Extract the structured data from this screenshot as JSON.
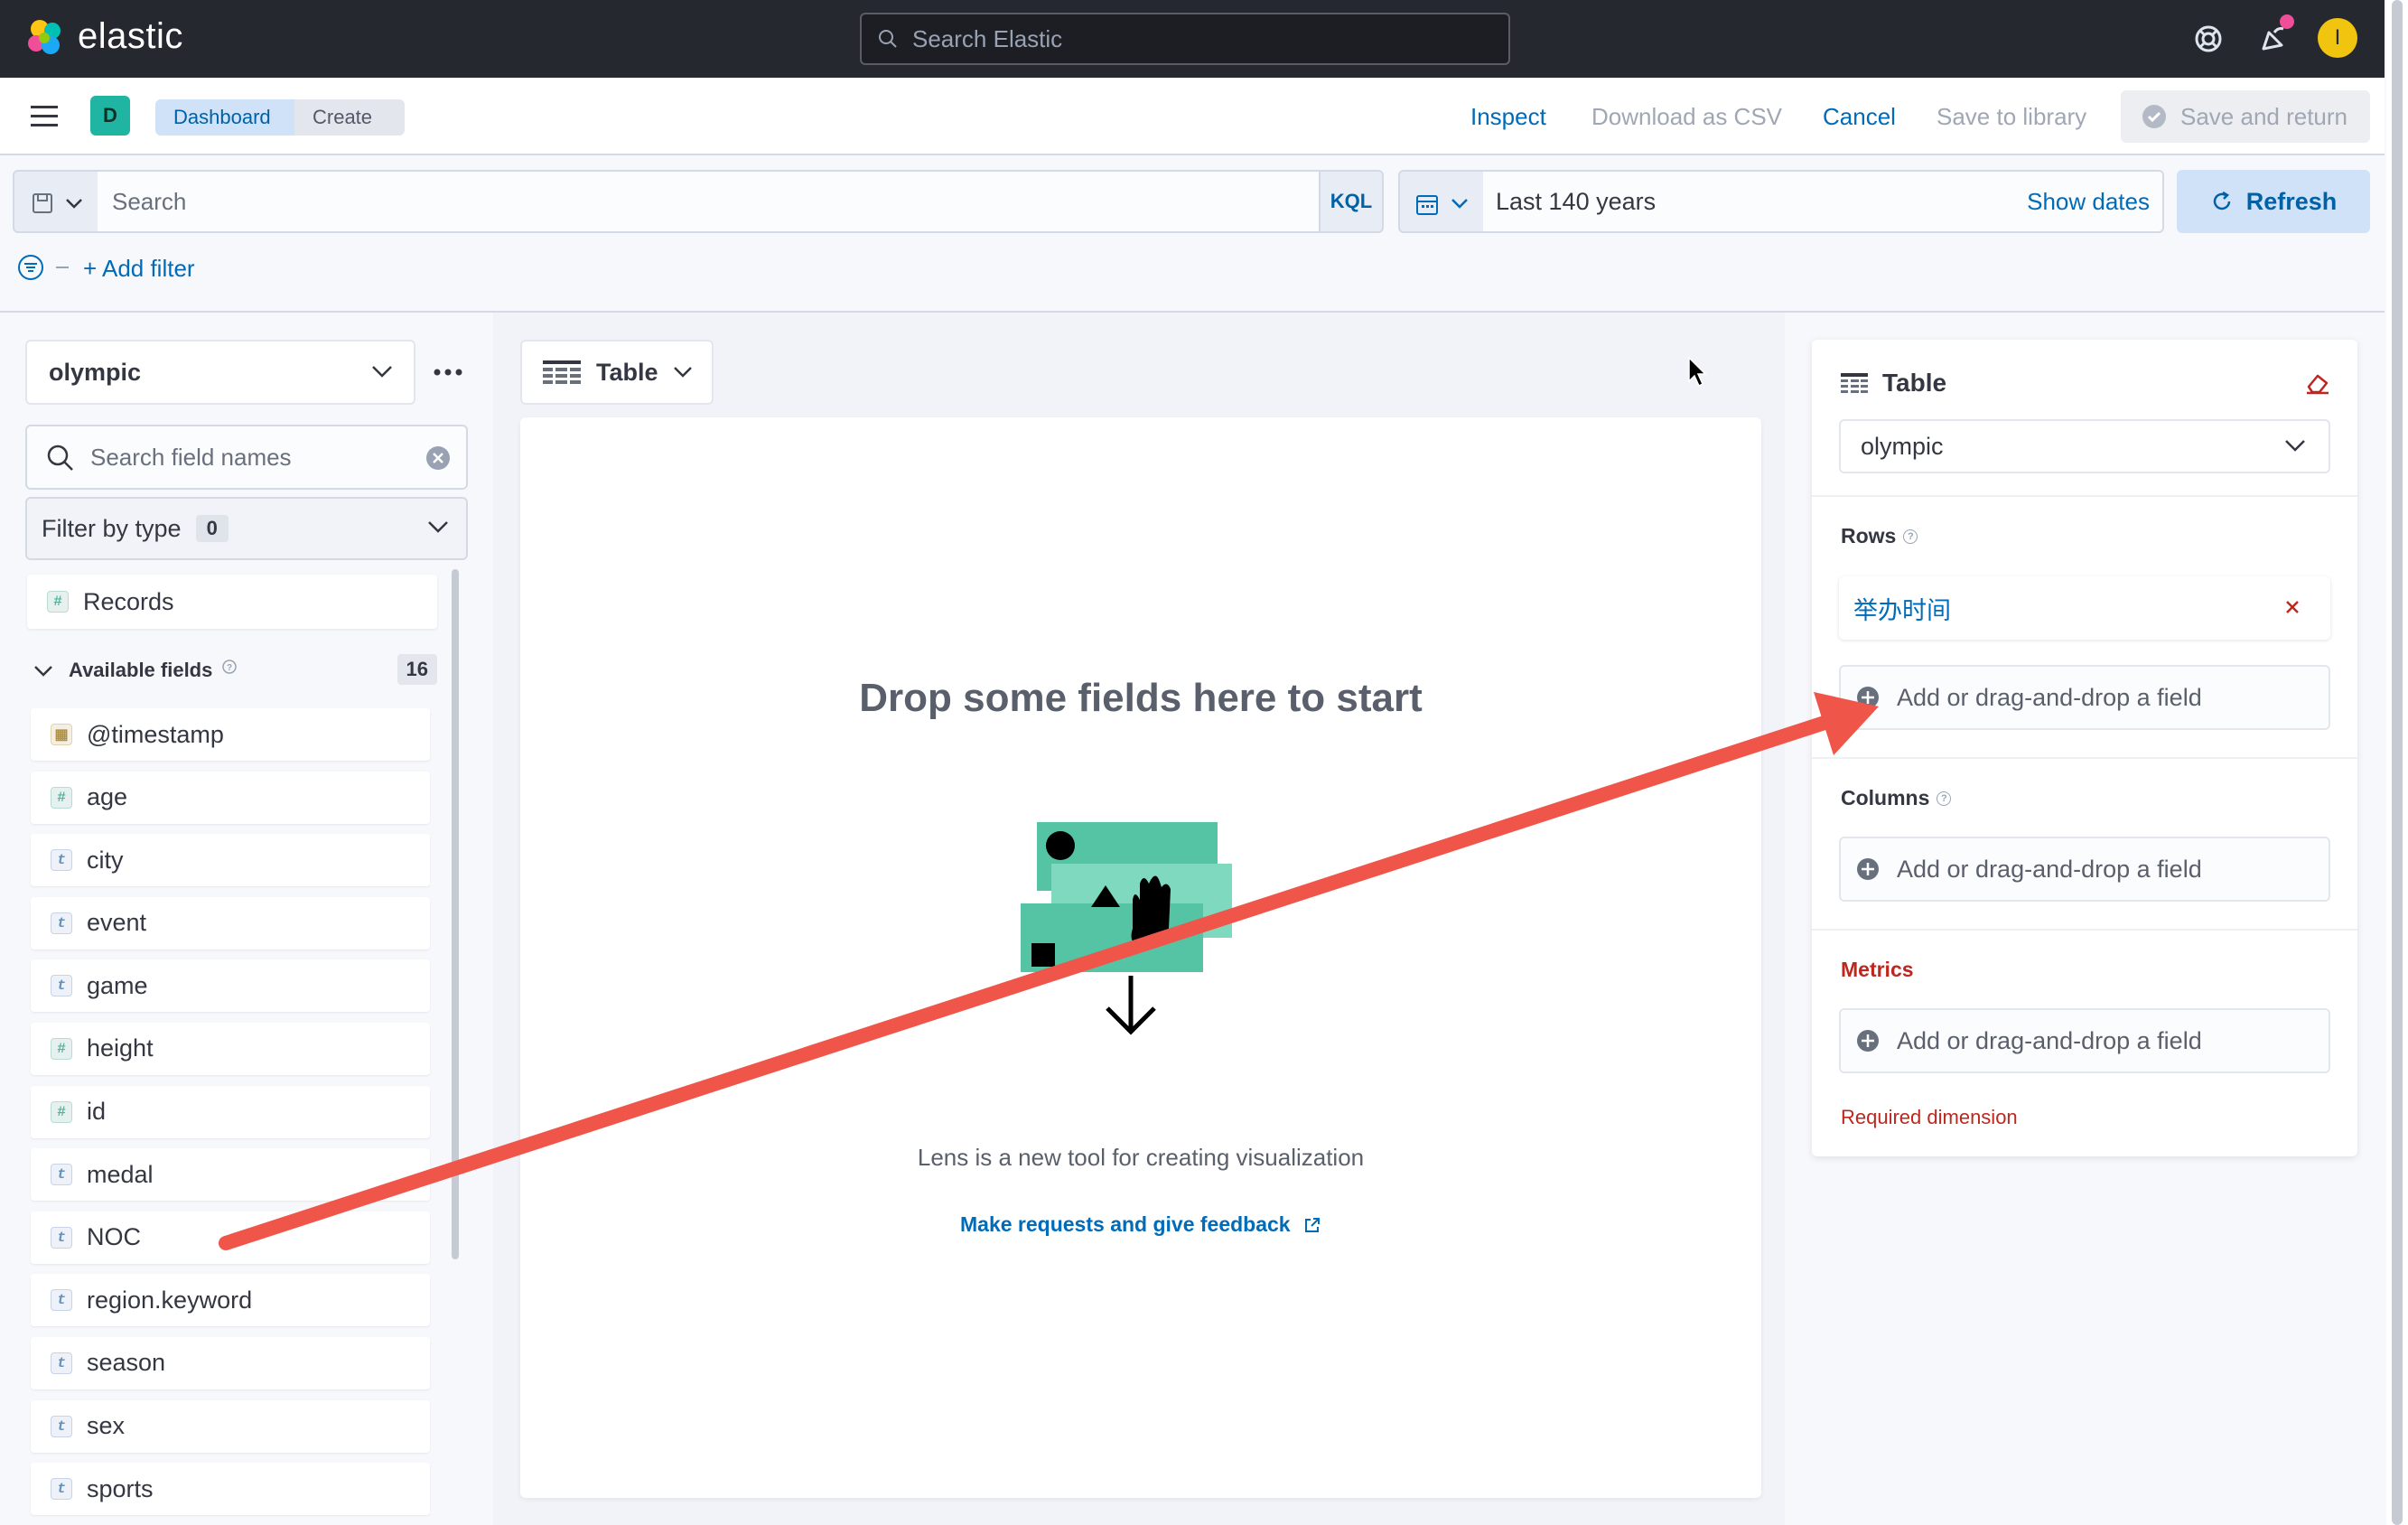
{
  "header": {
    "brand": "elastic",
    "search_placeholder": "Search Elastic",
    "avatar_initial": "I"
  },
  "appbar": {
    "space_initial": "D",
    "breadcrumbs": [
      "Dashboard",
      "Create"
    ],
    "inspect": "Inspect",
    "download_csv": "Download as CSV",
    "cancel": "Cancel",
    "save_to_library": "Save to library",
    "save_and_return": "Save and return"
  },
  "query": {
    "search_placeholder": "Search",
    "language": "KQL",
    "time_range": "Last 140 years",
    "show_dates": "Show dates",
    "refresh": "Refresh",
    "add_filter": "+ Add filter"
  },
  "left": {
    "index_pattern": "olympic",
    "field_search_placeholder": "Search field names",
    "filter_by_type": "Filter by type",
    "filter_count": "0",
    "records": "Records",
    "available_fields_label": "Available fields",
    "available_fields_count": "16",
    "fields": [
      {
        "name": "@timestamp",
        "type": "date"
      },
      {
        "name": "age",
        "type": "number"
      },
      {
        "name": "city",
        "type": "string"
      },
      {
        "name": "event",
        "type": "string"
      },
      {
        "name": "game",
        "type": "string"
      },
      {
        "name": "height",
        "type": "number"
      },
      {
        "name": "id",
        "type": "number"
      },
      {
        "name": "medal",
        "type": "string"
      },
      {
        "name": "NOC",
        "type": "string"
      },
      {
        "name": "region.keyword",
        "type": "string"
      },
      {
        "name": "season",
        "type": "string"
      },
      {
        "name": "sex",
        "type": "string"
      },
      {
        "name": "sports",
        "type": "string"
      }
    ]
  },
  "center": {
    "vis_type": "Table",
    "drop_title": "Drop some fields here to start",
    "lens_note": "Lens is a new tool for creating visualization",
    "feedback_link": "Make requests and give feedback"
  },
  "config": {
    "title": "Table",
    "index_pattern": "olympic",
    "rows_label": "Rows",
    "row_field": "举办时间",
    "add_field": "Add or drag-and-drop a field",
    "columns_label": "Columns",
    "metrics_label": "Metrics",
    "required": "Required dimension"
  },
  "colors": {
    "accent": "#006bb8",
    "annotation_arrow": "#f0554a",
    "danger": "#bd271e"
  }
}
